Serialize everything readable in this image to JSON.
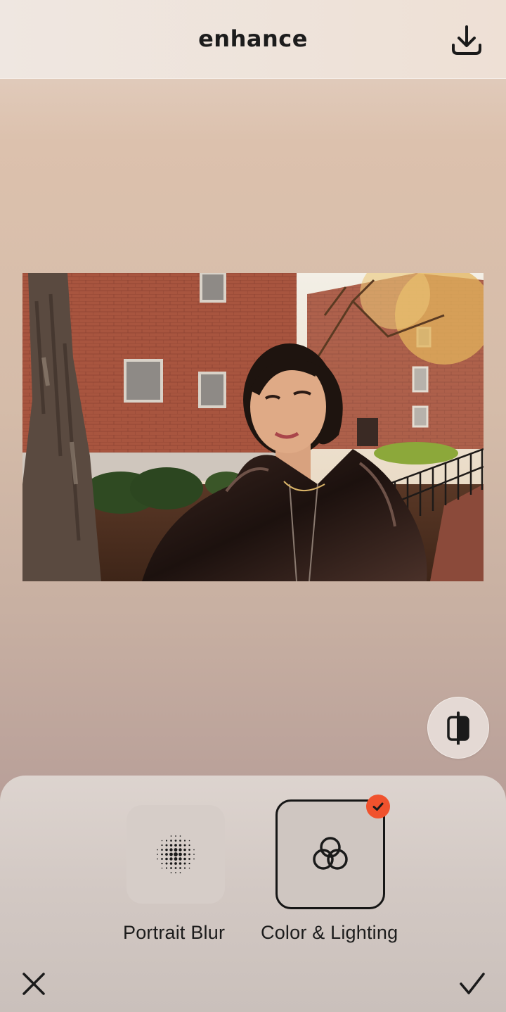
{
  "header": {
    "title": "enhance",
    "download_icon": "download-icon"
  },
  "photo": {
    "subject": "portrait-photo"
  },
  "compare": {
    "icon": "compare-split-icon"
  },
  "tools": [
    {
      "label": "Portrait Blur",
      "icon": "dot-grid-icon",
      "selected": false
    },
    {
      "label": "Color & Lighting",
      "icon": "overlapping-circles-icon",
      "selected": true
    }
  ],
  "footer": {
    "cancel_icon": "close-icon",
    "confirm_icon": "checkmark-icon"
  },
  "colors": {
    "accent": "#f0522d",
    "text": "#1c1c1c"
  }
}
